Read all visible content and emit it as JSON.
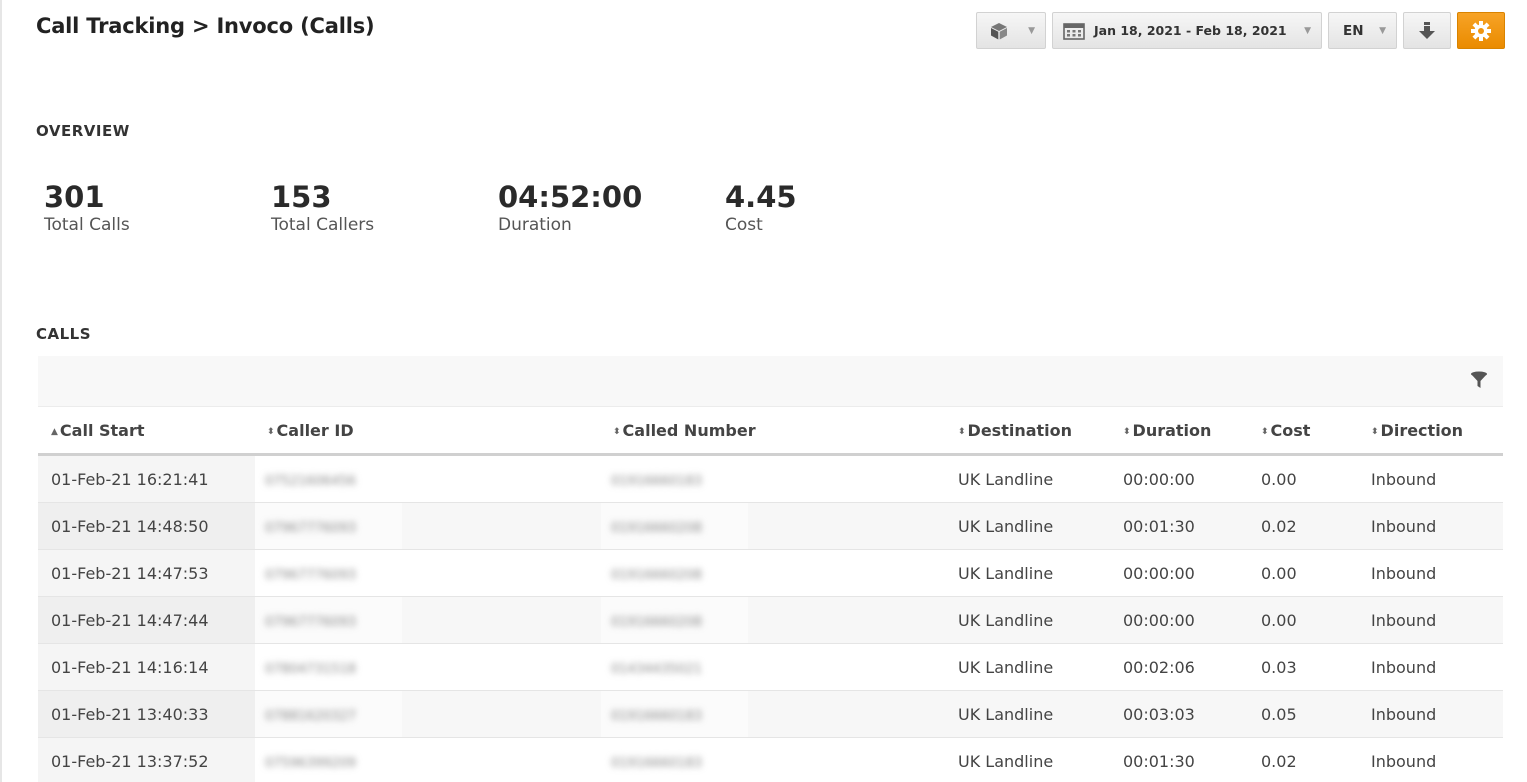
{
  "header": {
    "title": "Call Tracking > Invoco (Calls)"
  },
  "toolbar": {
    "cube_icon": "cube-icon",
    "date_range": "Jan 18, 2021 - Feb 18, 2021",
    "language": "EN",
    "download_icon": "download-icon",
    "settings_icon": "gear-icon",
    "accent_color": "#f39c12"
  },
  "overview": {
    "label": "OVERVIEW",
    "stats": [
      {
        "value": "301",
        "label": "Total Calls"
      },
      {
        "value": "153",
        "label": "Total Callers"
      },
      {
        "value": "04:52:00",
        "label": "Duration"
      },
      {
        "value": "4.45",
        "label": "Cost"
      }
    ]
  },
  "calls": {
    "label": "CALLS",
    "filter_icon": "filter-icon",
    "columns": [
      "Call Start",
      "Caller ID",
      "Called Number",
      "Destination",
      "Duration",
      "Cost",
      "Direction"
    ],
    "rows": [
      {
        "call_start": "01-Feb-21 16:21:41",
        "caller_id": "07521606456",
        "called_number": "01916660183",
        "destination": "UK Landline",
        "duration": "00:00:00",
        "cost": "0.00",
        "direction": "Inbound"
      },
      {
        "call_start": "01-Feb-21 14:48:50",
        "caller_id": "07967776093",
        "called_number": "01916660208",
        "destination": "UK Landline",
        "duration": "00:01:30",
        "cost": "0.02",
        "direction": "Inbound"
      },
      {
        "call_start": "01-Feb-21 14:47:53",
        "caller_id": "07967776093",
        "called_number": "01916660208",
        "destination": "UK Landline",
        "duration": "00:00:00",
        "cost": "0.00",
        "direction": "Inbound"
      },
      {
        "call_start": "01-Feb-21 14:47:44",
        "caller_id": "07967776093",
        "called_number": "01916660208",
        "destination": "UK Landline",
        "duration": "00:00:00",
        "cost": "0.00",
        "direction": "Inbound"
      },
      {
        "call_start": "01-Feb-21 14:16:14",
        "caller_id": "07804731518",
        "called_number": "01434435021",
        "destination": "UK Landline",
        "duration": "00:02:06",
        "cost": "0.03",
        "direction": "Inbound"
      },
      {
        "call_start": "01-Feb-21 13:40:33",
        "caller_id": "07881620327",
        "called_number": "01916660183",
        "destination": "UK Landline",
        "duration": "00:03:03",
        "cost": "0.05",
        "direction": "Inbound"
      },
      {
        "call_start": "01-Feb-21 13:37:52",
        "caller_id": "07596399209",
        "called_number": "01916660183",
        "destination": "UK Landline",
        "duration": "00:01:30",
        "cost": "0.02",
        "direction": "Inbound"
      }
    ]
  }
}
